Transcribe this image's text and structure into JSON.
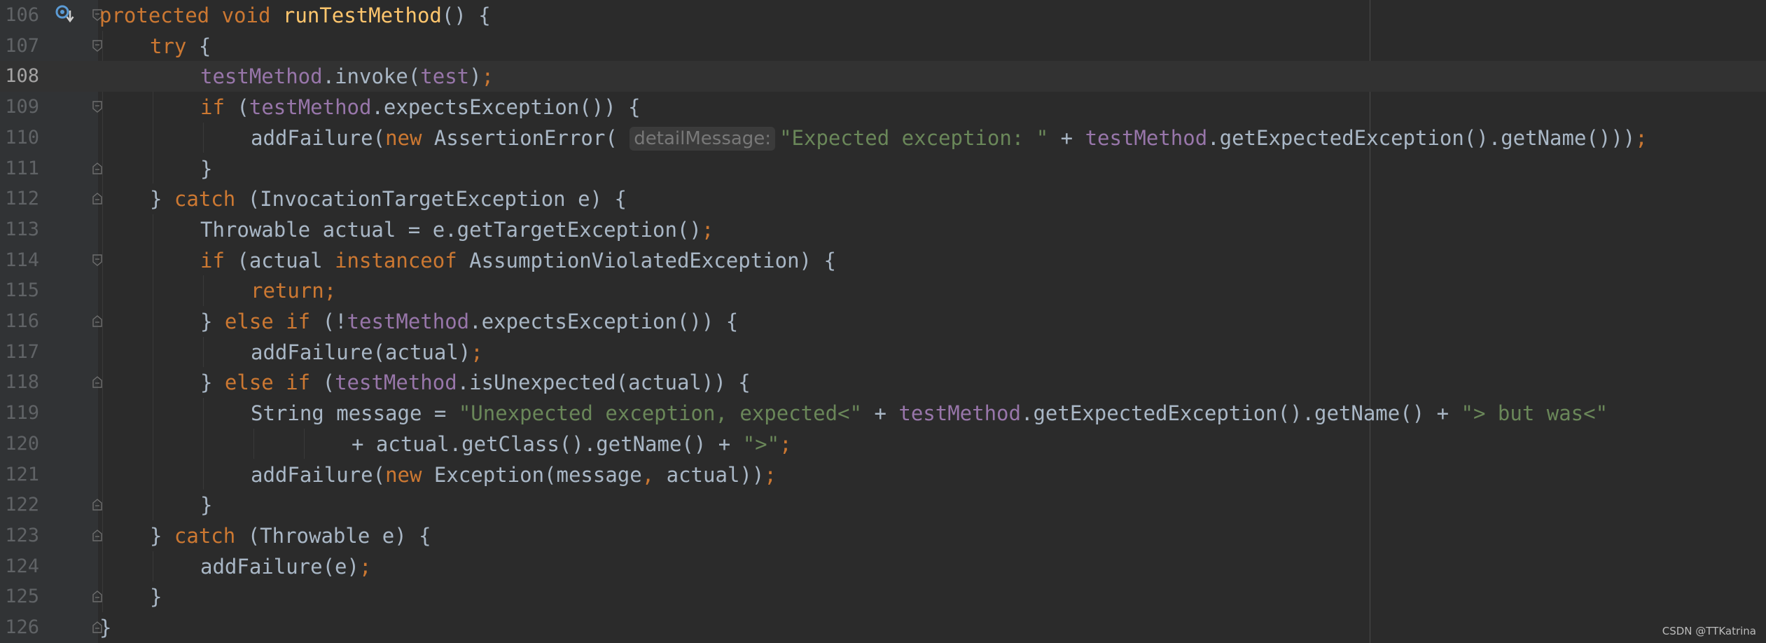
{
  "editor": {
    "lines": [
      {
        "num": "106",
        "indent": 0,
        "fold": "open",
        "gutter_icon": "override-method-icon",
        "tokens": [
          [
            "kw",
            "protected void "
          ],
          [
            "fn",
            "runTestMethod"
          ],
          [
            "p",
            "() {"
          ]
        ]
      },
      {
        "num": "107",
        "indent": 1,
        "fold": "open",
        "tokens": [
          [
            "kw",
            "try"
          ],
          [
            "p",
            " {"
          ]
        ]
      },
      {
        "num": "108",
        "indent": 2,
        "fold": "",
        "current": true,
        "tokens": [
          [
            "fld",
            "testMethod"
          ],
          [
            "p",
            ".invoke("
          ],
          [
            "fld",
            "test"
          ],
          [
            "p",
            ")"
          ],
          [
            "kw",
            ";"
          ]
        ]
      },
      {
        "num": "109",
        "indent": 2,
        "fold": "open",
        "tokens": [
          [
            "kw",
            "if "
          ],
          [
            "p",
            "("
          ],
          [
            "fld",
            "testMethod"
          ],
          [
            "p",
            ".expectsException()) {"
          ]
        ]
      },
      {
        "num": "110",
        "indent": 3,
        "fold": "",
        "tokens": [
          [
            "p",
            "addFailure("
          ],
          [
            "kw",
            "new "
          ],
          [
            "p",
            "AssertionError( "
          ],
          [
            "hint",
            "detailMessage:"
          ],
          [
            "str",
            "\"Expected exception: \""
          ],
          [
            "p",
            " + "
          ],
          [
            "fld",
            "testMethod"
          ],
          [
            "p",
            ".getExpectedException().getName()))"
          ],
          [
            "kw",
            ";"
          ]
        ]
      },
      {
        "num": "111",
        "indent": 2,
        "fold": "close",
        "tokens": [
          [
            "p",
            "}"
          ]
        ]
      },
      {
        "num": "112",
        "indent": 1,
        "fold": "close",
        "tokens": [
          [
            "p",
            "} "
          ],
          [
            "kw",
            "catch "
          ],
          [
            "p",
            "(InvocationTargetException e) {"
          ]
        ]
      },
      {
        "num": "113",
        "indent": 2,
        "fold": "",
        "tokens": [
          [
            "p",
            "Throwable actual = e.getTargetException()"
          ],
          [
            "kw",
            ";"
          ]
        ]
      },
      {
        "num": "114",
        "indent": 2,
        "fold": "open",
        "tokens": [
          [
            "kw",
            "if "
          ],
          [
            "p",
            "(actual "
          ],
          [
            "kw",
            "instanceof "
          ],
          [
            "p",
            "AssumptionViolatedException) {"
          ]
        ]
      },
      {
        "num": "115",
        "indent": 3,
        "fold": "",
        "tokens": [
          [
            "kw",
            "return;"
          ]
        ]
      },
      {
        "num": "116",
        "indent": 2,
        "fold": "close",
        "tokens": [
          [
            "p",
            "} "
          ],
          [
            "kw",
            "else if "
          ],
          [
            "p",
            "(!"
          ],
          [
            "fld",
            "testMethod"
          ],
          [
            "p",
            ".expectsException()) {"
          ]
        ]
      },
      {
        "num": "117",
        "indent": 3,
        "fold": "",
        "tokens": [
          [
            "p",
            "addFailure(actual)"
          ],
          [
            "kw",
            ";"
          ]
        ]
      },
      {
        "num": "118",
        "indent": 2,
        "fold": "close",
        "tokens": [
          [
            "p",
            "} "
          ],
          [
            "kw",
            "else if "
          ],
          [
            "p",
            "("
          ],
          [
            "fld",
            "testMethod"
          ],
          [
            "p",
            ".isUnexpected(actual)) {"
          ]
        ]
      },
      {
        "num": "119",
        "indent": 3,
        "fold": "",
        "tokens": [
          [
            "p",
            "String message = "
          ],
          [
            "str",
            "\"Unexpected exception, expected<\""
          ],
          [
            "p",
            " + "
          ],
          [
            "fld",
            "testMethod"
          ],
          [
            "p",
            ".getExpectedException().getName() + "
          ],
          [
            "str",
            "\"> but was<\""
          ]
        ]
      },
      {
        "num": "120",
        "indent": 5,
        "fold": "",
        "tokens": [
          [
            "p",
            "+ actual.getClass().getName() + "
          ],
          [
            "str",
            "\">\""
          ],
          [
            "kw",
            ";"
          ]
        ]
      },
      {
        "num": "121",
        "indent": 3,
        "fold": "",
        "tokens": [
          [
            "p",
            "addFailure("
          ],
          [
            "kw",
            "new "
          ],
          [
            "p",
            "Exception(message"
          ],
          [
            "kw",
            ", "
          ],
          [
            "p",
            "actual))"
          ],
          [
            "kw",
            ";"
          ]
        ]
      },
      {
        "num": "122",
        "indent": 2,
        "fold": "close",
        "tokens": [
          [
            "p",
            "}"
          ]
        ]
      },
      {
        "num": "123",
        "indent": 1,
        "fold": "close",
        "tokens": [
          [
            "p",
            "} "
          ],
          [
            "kw",
            "catch "
          ],
          [
            "p",
            "(Throwable e) {"
          ]
        ]
      },
      {
        "num": "124",
        "indent": 2,
        "fold": "",
        "tokens": [
          [
            "p",
            "addFailure(e)"
          ],
          [
            "kw",
            ";"
          ]
        ]
      },
      {
        "num": "125",
        "indent": 1,
        "fold": "close",
        "tokens": [
          [
            "p",
            "}"
          ]
        ]
      },
      {
        "num": "126",
        "indent": 0,
        "fold": "close",
        "tokens": [
          [
            "p",
            "}"
          ]
        ]
      }
    ]
  },
  "watermark": "CSDN @TTKatrina",
  "colors": {
    "background": "#2b2b2b",
    "gutter": "#313335",
    "keyword": "#cc7832",
    "method_declaration": "#ffc66d",
    "field": "#9876aa",
    "string": "#6a8759",
    "plain": "#a9b7c6",
    "line_number": "#606366"
  }
}
